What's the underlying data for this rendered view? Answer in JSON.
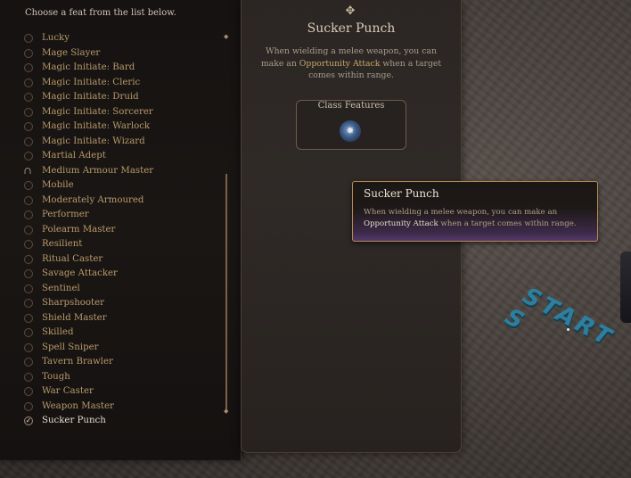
{
  "left_panel": {
    "hint": "Choose a feat from the list below.",
    "feats": [
      {
        "label": "Lucky",
        "state": "normal"
      },
      {
        "label": "Mage Slayer",
        "state": "normal"
      },
      {
        "label": "Magic Initiate: Bard",
        "state": "normal"
      },
      {
        "label": "Magic Initiate: Cleric",
        "state": "normal"
      },
      {
        "label": "Magic Initiate: Druid",
        "state": "normal"
      },
      {
        "label": "Magic Initiate: Sorcerer",
        "state": "normal"
      },
      {
        "label": "Magic Initiate: Warlock",
        "state": "normal"
      },
      {
        "label": "Magic Initiate: Wizard",
        "state": "normal"
      },
      {
        "label": "Martial Adept",
        "state": "normal"
      },
      {
        "label": "Medium Armour Master",
        "state": "locked"
      },
      {
        "label": "Mobile",
        "state": "normal"
      },
      {
        "label": "Moderately Armoured",
        "state": "normal"
      },
      {
        "label": "Performer",
        "state": "normal"
      },
      {
        "label": "Polearm Master",
        "state": "normal"
      },
      {
        "label": "Resilient",
        "state": "normal"
      },
      {
        "label": "Ritual Caster",
        "state": "normal"
      },
      {
        "label": "Savage Attacker",
        "state": "normal"
      },
      {
        "label": "Sentinel",
        "state": "normal"
      },
      {
        "label": "Sharpshooter",
        "state": "normal"
      },
      {
        "label": "Shield Master",
        "state": "normal"
      },
      {
        "label": "Skilled",
        "state": "normal"
      },
      {
        "label": "Spell Sniper",
        "state": "normal"
      },
      {
        "label": "Tavern Brawler",
        "state": "normal"
      },
      {
        "label": "Tough",
        "state": "normal"
      },
      {
        "label": "War Caster",
        "state": "normal"
      },
      {
        "label": "Weapon Master",
        "state": "normal"
      },
      {
        "label": "Sucker Punch",
        "state": "selected"
      }
    ]
  },
  "detail": {
    "title": "Sucker Punch",
    "desc_pre": "When wielding a melee weapon, you can make an ",
    "desc_highlight": "Opportunity Attack",
    "desc_post": " when a target comes within range.",
    "features_label": "Class Features"
  },
  "tooltip": {
    "title": "Sucker Punch",
    "desc_pre": "When wielding a melee weapon, you can make an ",
    "desc_highlight": "Opportunity Attack",
    "desc_post": " when a target comes within range."
  },
  "world": {
    "start_text": "START S"
  },
  "colors": {
    "panel_bg": "#1a1614",
    "gold_text": "#c9a56b",
    "feat_text": "#b89a6a",
    "tooltip_border": "#b58a4e",
    "start_text": "#2e7f9e"
  }
}
